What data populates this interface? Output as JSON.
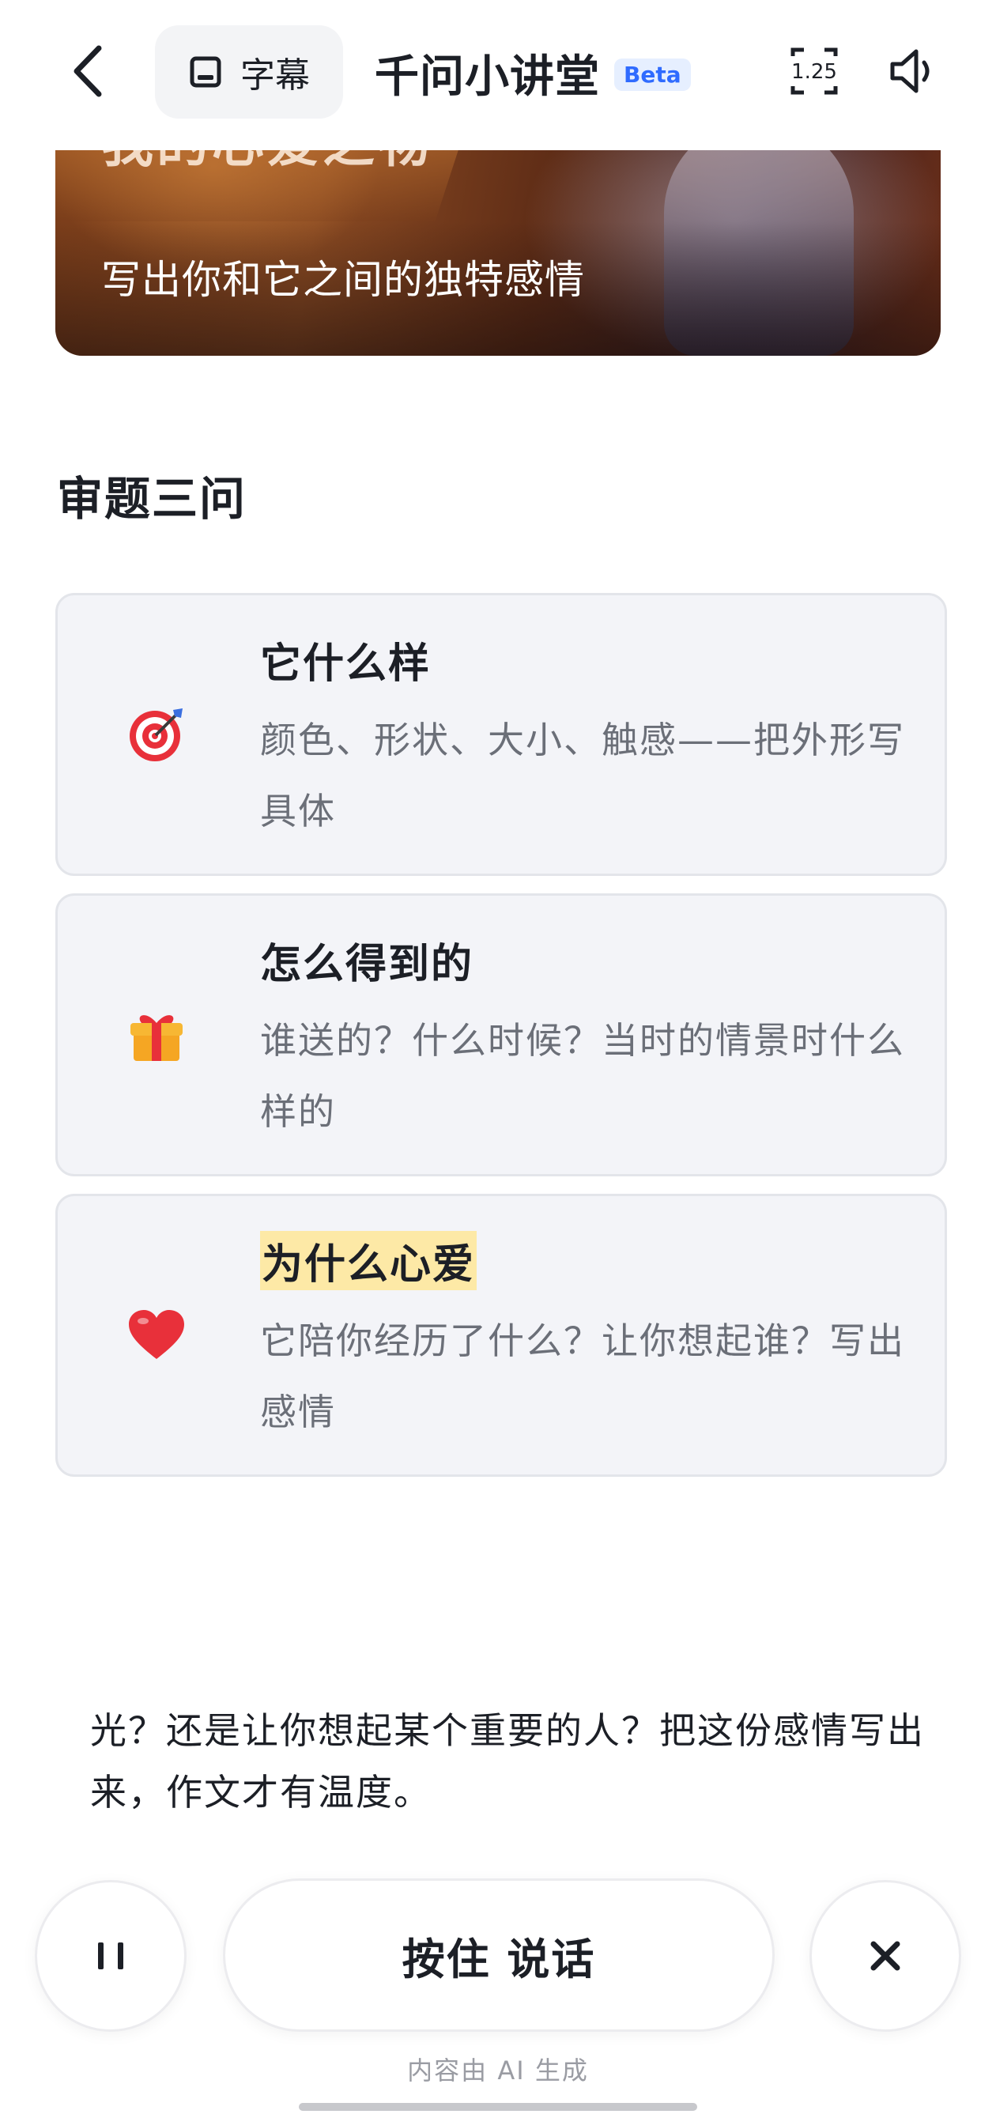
{
  "header": {
    "subtitle_label": "字幕",
    "title": "千问小讲堂",
    "beta": "Beta",
    "speed": "1.25"
  },
  "banner": {
    "heading": "我的心爱之物",
    "subheading": "写出你和它之间的独特感情"
  },
  "section": {
    "title": "审题三问",
    "cards": [
      {
        "icon": "target-icon",
        "emoji": "🎯",
        "title": "它什么样",
        "desc": "颜色、形状、大小、触感——把外形写具体",
        "highlight": false
      },
      {
        "icon": "gift-icon",
        "emoji": "🎁",
        "title": "怎么得到的",
        "desc": "谁送的？什么时候？当时的情景时什么样的",
        "highlight": false
      },
      {
        "icon": "heart-icon",
        "emoji": "❤️",
        "title": "为什么心爱",
        "desc": "它陪你经历了什么？让你想起谁？写出感情",
        "highlight": true
      }
    ]
  },
  "caption": "光？还是让你想起某个重要的人？把这份感情写出来，作文才有温度。",
  "controls": {
    "talk_label": "按住 说话",
    "ai_note": "内容由 AI 生成"
  },
  "colors": {
    "highlight": "#fde9a6",
    "beta": "#2f6bff",
    "card_bg": "#f3f4f8"
  }
}
